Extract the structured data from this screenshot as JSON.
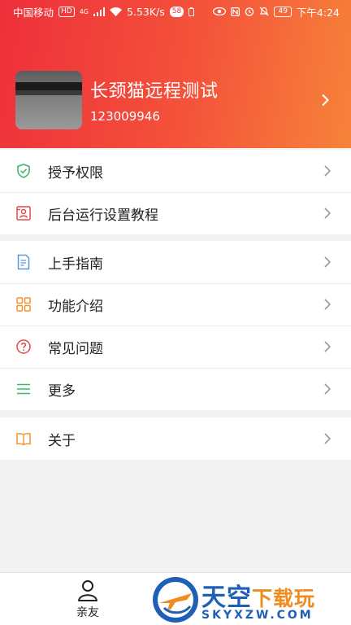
{
  "status_bar": {
    "carrier": "中国移动",
    "carrier_badge": "HD",
    "network": "4G",
    "speed": "5.53K/s",
    "app_badge": "58",
    "battery": "49",
    "time": "下午4:24"
  },
  "profile": {
    "name": "长颈猫远程测试",
    "id": "123009946"
  },
  "groups": [
    {
      "items": [
        {
          "label": "授予权限",
          "icon": "shield-check-icon"
        },
        {
          "label": "后台运行设置教程",
          "icon": "background-run-icon"
        }
      ]
    },
    {
      "items": [
        {
          "label": "上手指南",
          "icon": "guide-document-icon"
        },
        {
          "label": "功能介绍",
          "icon": "grid-icon"
        },
        {
          "label": "常见问题",
          "icon": "question-circle-icon"
        },
        {
          "label": "更多",
          "icon": "menu-lines-icon"
        }
      ]
    },
    {
      "items": [
        {
          "label": "关于",
          "icon": "book-icon"
        }
      ]
    }
  ],
  "tabbar": {
    "friends_label": "亲友"
  },
  "watermark": {
    "title_main": "天空",
    "title_accent": "下载玩",
    "subtitle": "SKYXZW.COM"
  },
  "colors": {
    "header_start": "#ee2f3b",
    "header_end": "#f7833a",
    "icon_green": "#3cb96a",
    "icon_red": "#e04848",
    "icon_blue": "#5b9bd5",
    "icon_orange": "#f0942f"
  }
}
